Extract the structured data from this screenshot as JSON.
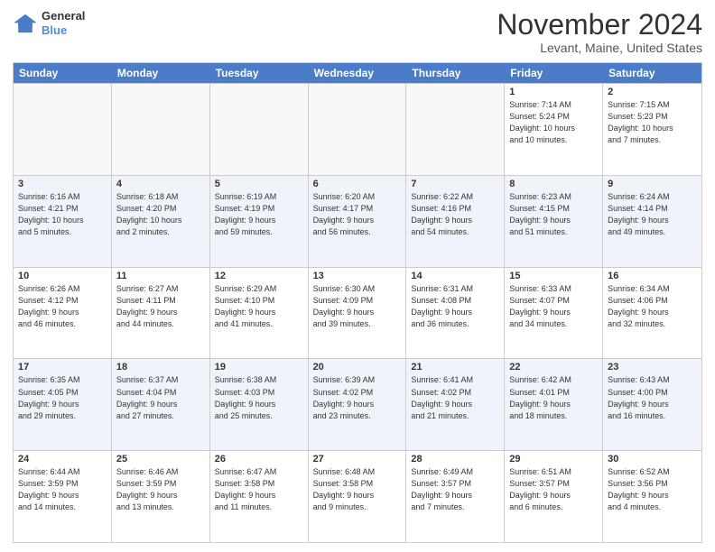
{
  "logo": {
    "line1": "General",
    "line2": "Blue"
  },
  "title": "November 2024",
  "subtitle": "Levant, Maine, United States",
  "headers": [
    "Sunday",
    "Monday",
    "Tuesday",
    "Wednesday",
    "Thursday",
    "Friday",
    "Saturday"
  ],
  "rows": [
    {
      "alt": false,
      "cells": [
        {
          "day": "",
          "info": ""
        },
        {
          "day": "",
          "info": ""
        },
        {
          "day": "",
          "info": ""
        },
        {
          "day": "",
          "info": ""
        },
        {
          "day": "",
          "info": ""
        },
        {
          "day": "1",
          "info": "Sunrise: 7:14 AM\nSunset: 5:24 PM\nDaylight: 10 hours\nand 10 minutes."
        },
        {
          "day": "2",
          "info": "Sunrise: 7:15 AM\nSunset: 5:23 PM\nDaylight: 10 hours\nand 7 minutes."
        }
      ]
    },
    {
      "alt": true,
      "cells": [
        {
          "day": "3",
          "info": "Sunrise: 6:16 AM\nSunset: 4:21 PM\nDaylight: 10 hours\nand 5 minutes."
        },
        {
          "day": "4",
          "info": "Sunrise: 6:18 AM\nSunset: 4:20 PM\nDaylight: 10 hours\nand 2 minutes."
        },
        {
          "day": "5",
          "info": "Sunrise: 6:19 AM\nSunset: 4:19 PM\nDaylight: 9 hours\nand 59 minutes."
        },
        {
          "day": "6",
          "info": "Sunrise: 6:20 AM\nSunset: 4:17 PM\nDaylight: 9 hours\nand 56 minutes."
        },
        {
          "day": "7",
          "info": "Sunrise: 6:22 AM\nSunset: 4:16 PM\nDaylight: 9 hours\nand 54 minutes."
        },
        {
          "day": "8",
          "info": "Sunrise: 6:23 AM\nSunset: 4:15 PM\nDaylight: 9 hours\nand 51 minutes."
        },
        {
          "day": "9",
          "info": "Sunrise: 6:24 AM\nSunset: 4:14 PM\nDaylight: 9 hours\nand 49 minutes."
        }
      ]
    },
    {
      "alt": false,
      "cells": [
        {
          "day": "10",
          "info": "Sunrise: 6:26 AM\nSunset: 4:12 PM\nDaylight: 9 hours\nand 46 minutes."
        },
        {
          "day": "11",
          "info": "Sunrise: 6:27 AM\nSunset: 4:11 PM\nDaylight: 9 hours\nand 44 minutes."
        },
        {
          "day": "12",
          "info": "Sunrise: 6:29 AM\nSunset: 4:10 PM\nDaylight: 9 hours\nand 41 minutes."
        },
        {
          "day": "13",
          "info": "Sunrise: 6:30 AM\nSunset: 4:09 PM\nDaylight: 9 hours\nand 39 minutes."
        },
        {
          "day": "14",
          "info": "Sunrise: 6:31 AM\nSunset: 4:08 PM\nDaylight: 9 hours\nand 36 minutes."
        },
        {
          "day": "15",
          "info": "Sunrise: 6:33 AM\nSunset: 4:07 PM\nDaylight: 9 hours\nand 34 minutes."
        },
        {
          "day": "16",
          "info": "Sunrise: 6:34 AM\nSunset: 4:06 PM\nDaylight: 9 hours\nand 32 minutes."
        }
      ]
    },
    {
      "alt": true,
      "cells": [
        {
          "day": "17",
          "info": "Sunrise: 6:35 AM\nSunset: 4:05 PM\nDaylight: 9 hours\nand 29 minutes."
        },
        {
          "day": "18",
          "info": "Sunrise: 6:37 AM\nSunset: 4:04 PM\nDaylight: 9 hours\nand 27 minutes."
        },
        {
          "day": "19",
          "info": "Sunrise: 6:38 AM\nSunset: 4:03 PM\nDaylight: 9 hours\nand 25 minutes."
        },
        {
          "day": "20",
          "info": "Sunrise: 6:39 AM\nSunset: 4:02 PM\nDaylight: 9 hours\nand 23 minutes."
        },
        {
          "day": "21",
          "info": "Sunrise: 6:41 AM\nSunset: 4:02 PM\nDaylight: 9 hours\nand 21 minutes."
        },
        {
          "day": "22",
          "info": "Sunrise: 6:42 AM\nSunset: 4:01 PM\nDaylight: 9 hours\nand 18 minutes."
        },
        {
          "day": "23",
          "info": "Sunrise: 6:43 AM\nSunset: 4:00 PM\nDaylight: 9 hours\nand 16 minutes."
        }
      ]
    },
    {
      "alt": false,
      "cells": [
        {
          "day": "24",
          "info": "Sunrise: 6:44 AM\nSunset: 3:59 PM\nDaylight: 9 hours\nand 14 minutes."
        },
        {
          "day": "25",
          "info": "Sunrise: 6:46 AM\nSunset: 3:59 PM\nDaylight: 9 hours\nand 13 minutes."
        },
        {
          "day": "26",
          "info": "Sunrise: 6:47 AM\nSunset: 3:58 PM\nDaylight: 9 hours\nand 11 minutes."
        },
        {
          "day": "27",
          "info": "Sunrise: 6:48 AM\nSunset: 3:58 PM\nDaylight: 9 hours\nand 9 minutes."
        },
        {
          "day": "28",
          "info": "Sunrise: 6:49 AM\nSunset: 3:57 PM\nDaylight: 9 hours\nand 7 minutes."
        },
        {
          "day": "29",
          "info": "Sunrise: 6:51 AM\nSunset: 3:57 PM\nDaylight: 9 hours\nand 6 minutes."
        },
        {
          "day": "30",
          "info": "Sunrise: 6:52 AM\nSunset: 3:56 PM\nDaylight: 9 hours\nand 4 minutes."
        }
      ]
    }
  ]
}
